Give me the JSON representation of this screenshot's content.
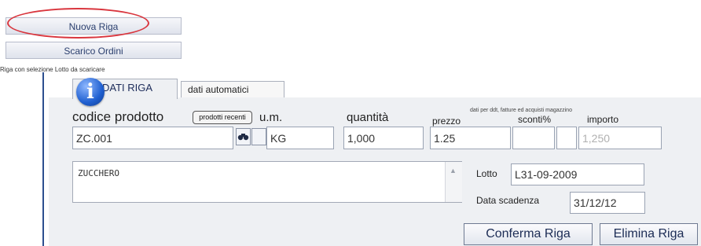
{
  "left_menu": {
    "nuova_riga": "Nuova Riga",
    "scarico_ordini": "Scarico Ordini",
    "caption": "Riga con selezione Lotto da scaricare"
  },
  "tabs": [
    {
      "label": "DATI RIGA"
    },
    {
      "label": "dati automatici"
    }
  ],
  "form": {
    "labels": {
      "codice_prodotto": "codice prodotto",
      "prodotti_recenti": "prodotti recenti",
      "um": "u.m.",
      "quantita": "quantità",
      "prezzo": "prezzo",
      "note_header": "dati per ddt, fatture ed acquisti magazzino",
      "sconti": "sconti%",
      "importo": "importo",
      "lotto": "Lotto",
      "data_scadenza": "Data scadenza"
    },
    "values": {
      "codice": "ZC.001",
      "um": "KG",
      "quantita": "1,000",
      "prezzo": "1.25",
      "sconto1": "",
      "sconto2": "",
      "importo": "1,250",
      "descrizione": "ZUCCHERO",
      "lotto": "L31-09-2009",
      "data_scadenza": "31/12/12"
    }
  },
  "buttons": {
    "conferma": "Conferma Riga",
    "elimina": "Elimina Riga"
  },
  "icons": {
    "info": "info-icon",
    "binoculars": "binoculars-icon",
    "highlight": "red-oval-highlight"
  },
  "colors": {
    "highlight": "#d9363e",
    "accent": "#2d4f8f"
  }
}
